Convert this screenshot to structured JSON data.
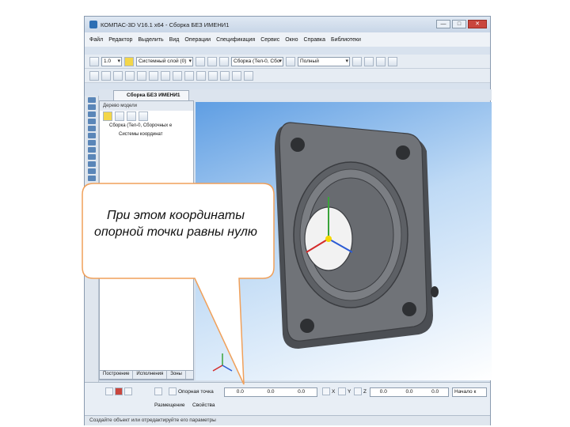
{
  "window": {
    "title": "КОМПАС-3D V16.1 x64 - Сборка БЕЗ ИМЕНИ1",
    "buttons": [
      "—",
      "□",
      "✕"
    ]
  },
  "menu": [
    "Файл",
    "Редактор",
    "Выделить",
    "Вид",
    "Операции",
    "Спецификация",
    "Сервис",
    "Окно",
    "Справка",
    "Библиотеки"
  ],
  "toolbar": {
    "scale_value": "1.0",
    "layer_value": "Системный слой (0)",
    "filter_value": "Сборка (Тел-0, Сбо",
    "display_mode": "Полный"
  },
  "document_tab": "Сборка БЕЗ ИМЕНИ1",
  "tree": {
    "header": "Дерево модели",
    "items": [
      {
        "label": "Сборка (Тел-0, Сборочных е"
      },
      {
        "label": "Системы координат"
      }
    ],
    "tabs": [
      "Построение",
      "Исполнения",
      "Зоны"
    ]
  },
  "properties": {
    "point_label": "Опорная точка",
    "point_x": "0.0",
    "point_y": "0.0",
    "point_z": "0.0",
    "x_label": "X",
    "y_label": "Y",
    "z_label": "Z",
    "value_x": "0.0",
    "value_y": "0.0",
    "value_z": "0.0",
    "start_label": "Начало к",
    "tabs": [
      "Размещение",
      "Свойства"
    ]
  },
  "status": "Создайте объект или отредактируйте его параметры",
  "callout_text": "При этом координаты опорной точки равны нулю",
  "colors": {
    "viewport_top": "#5f9ee3",
    "part_body": "#6b6e73",
    "callout_border": "#f0a05a"
  }
}
